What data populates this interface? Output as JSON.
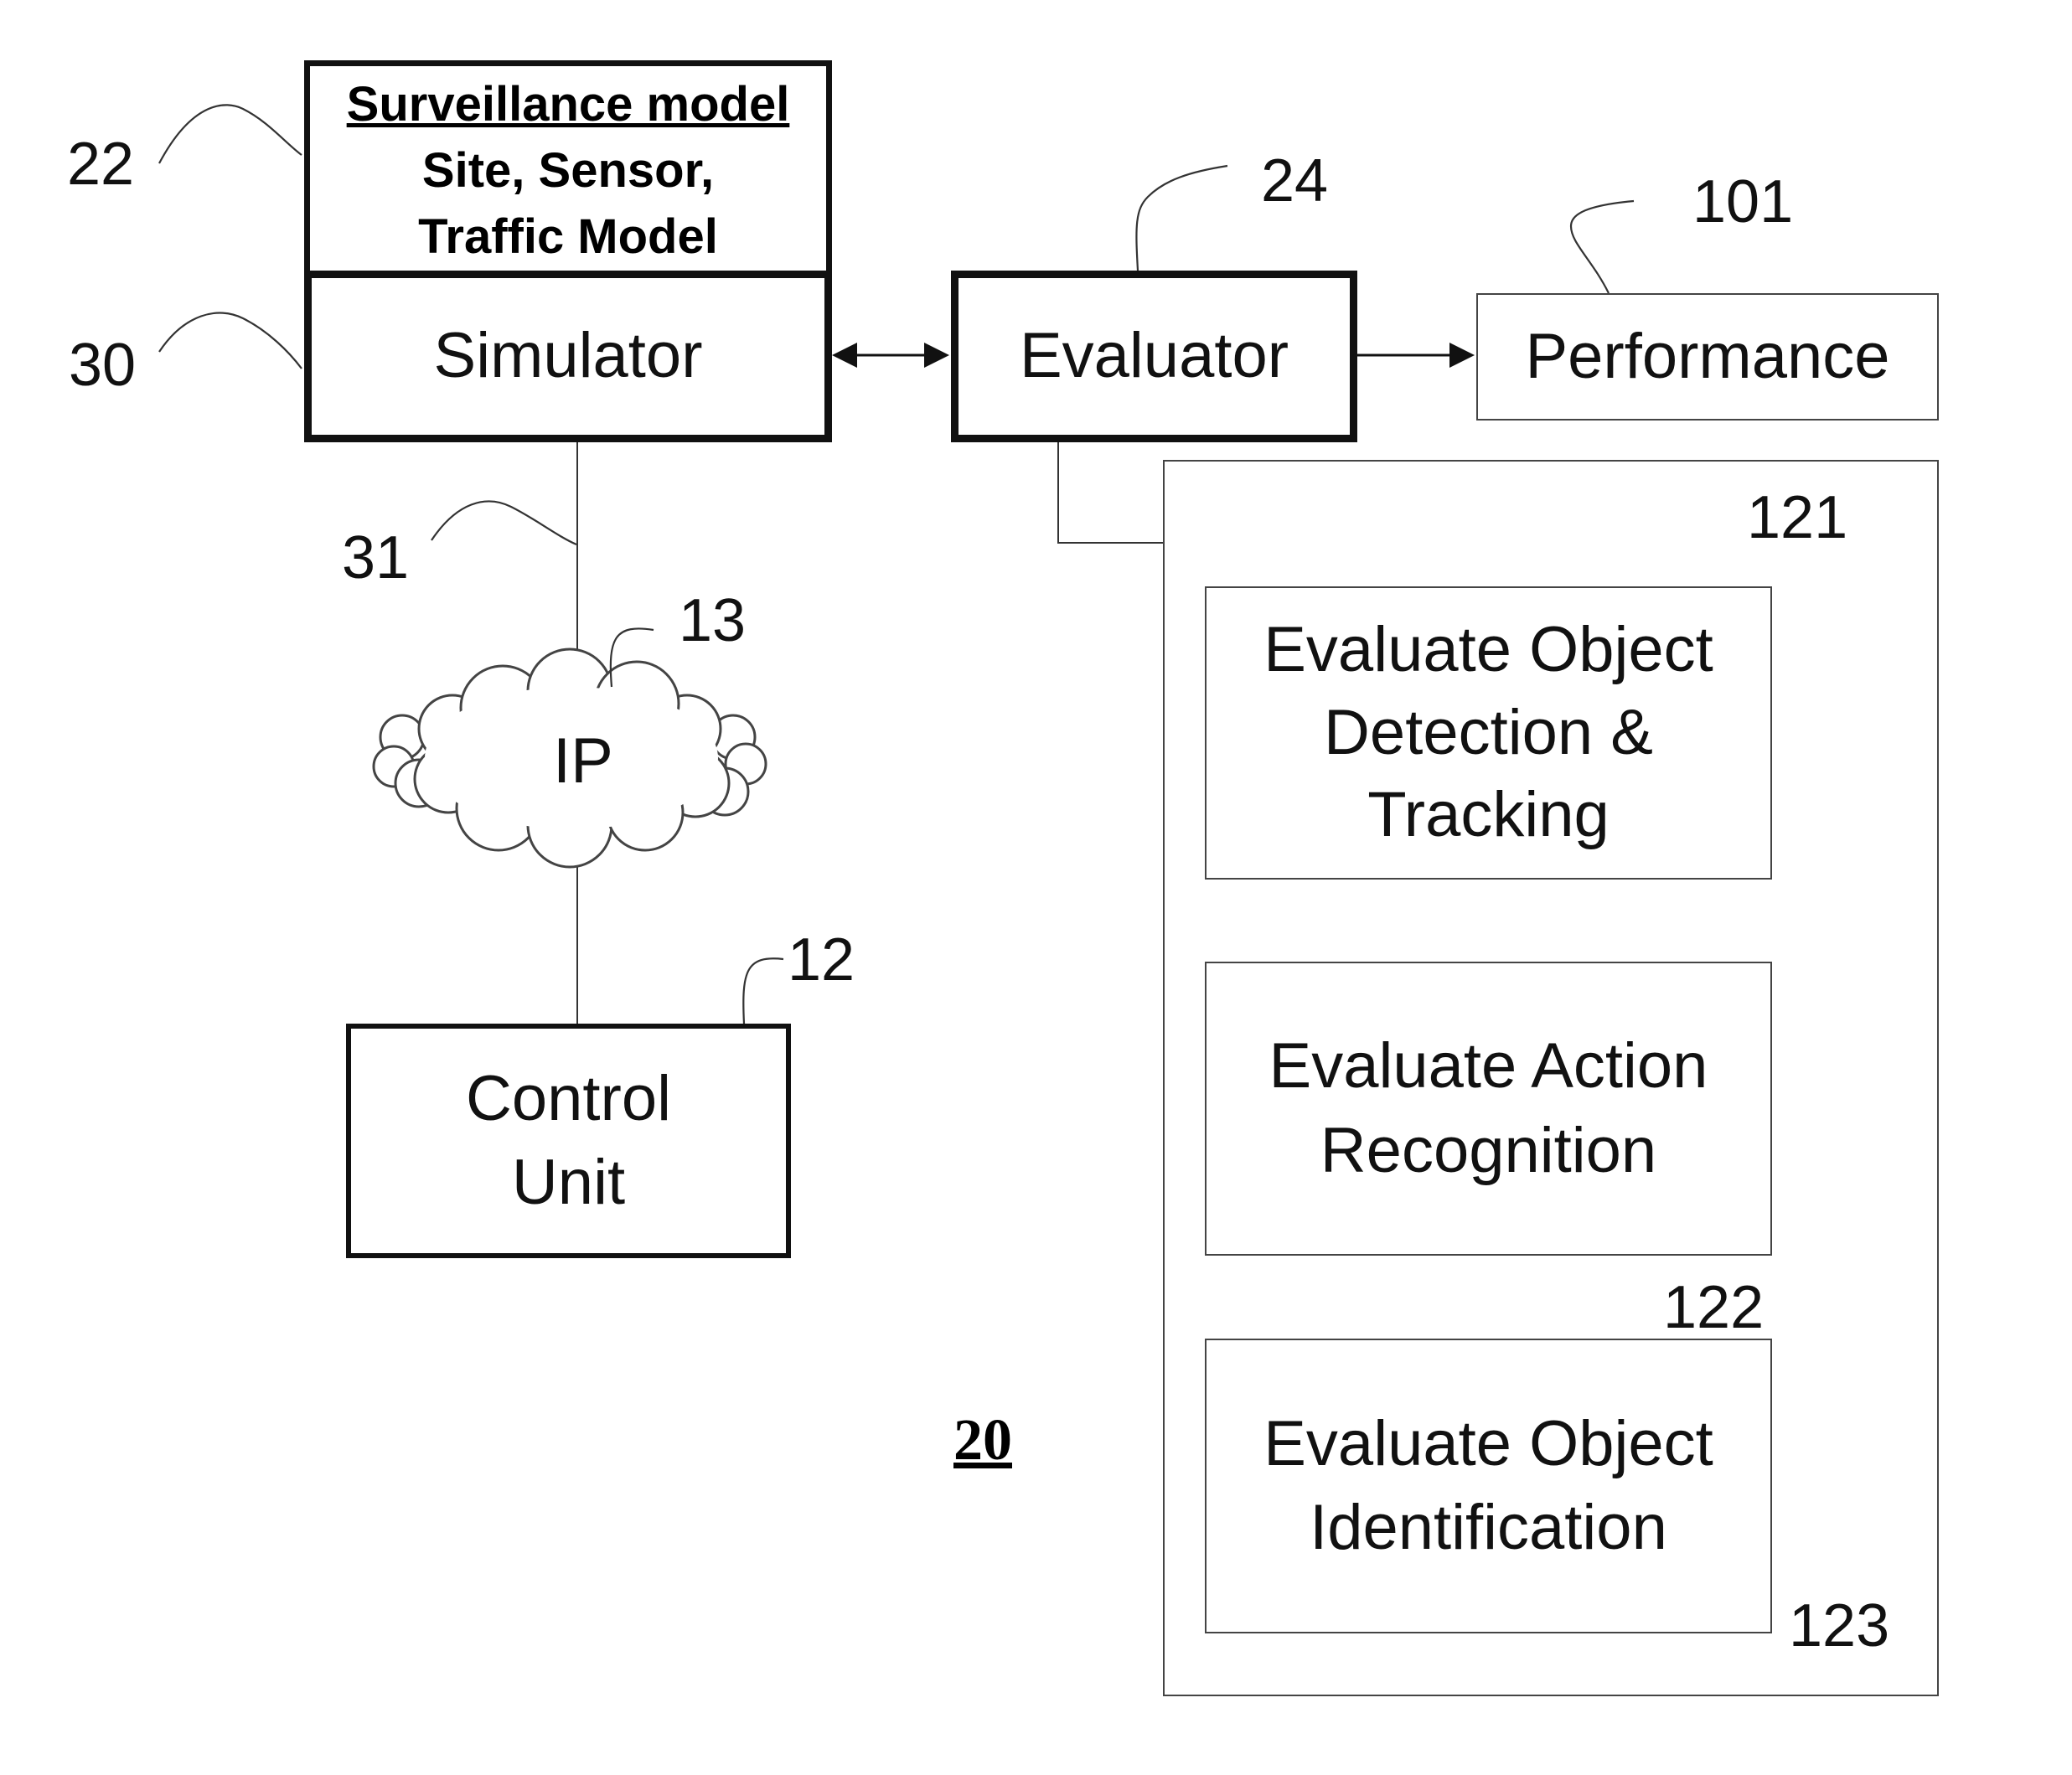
{
  "figure_label": "20",
  "blocks": {
    "surveillance_model": {
      "ref": "22",
      "title": "Surveillance model",
      "body_line1": "Site, Sensor,",
      "body_line2": "Traffic Model"
    },
    "simulator": {
      "ref": "30",
      "label": "Simulator"
    },
    "evaluator": {
      "ref": "24",
      "label": "Evaluator"
    },
    "performance": {
      "ref": "101",
      "label": "Performance"
    },
    "network": {
      "ref": "13",
      "label": "IP"
    },
    "link": {
      "ref": "31"
    },
    "control_unit": {
      "ref": "12",
      "line1": "Control",
      "line2": "Unit"
    },
    "evaluations": [
      {
        "ref": "121",
        "line1": "Evaluate Object",
        "line2": "Detection &",
        "line3": "Tracking"
      },
      {
        "ref": "122",
        "line1": "Evaluate Action",
        "line2": "Recognition"
      },
      {
        "ref": "123",
        "line1": "Evaluate Object",
        "line2": "Identification"
      }
    ]
  },
  "connections": [
    {
      "from": "simulator",
      "to": "evaluator",
      "type": "bidirectional-arrow"
    },
    {
      "from": "evaluator",
      "to": "performance",
      "type": "arrow"
    },
    {
      "from": "simulator",
      "to": "network",
      "type": "line"
    },
    {
      "from": "network",
      "to": "control_unit",
      "type": "line"
    },
    {
      "from": "evaluator",
      "to": "evaluations",
      "type": "line"
    }
  ]
}
